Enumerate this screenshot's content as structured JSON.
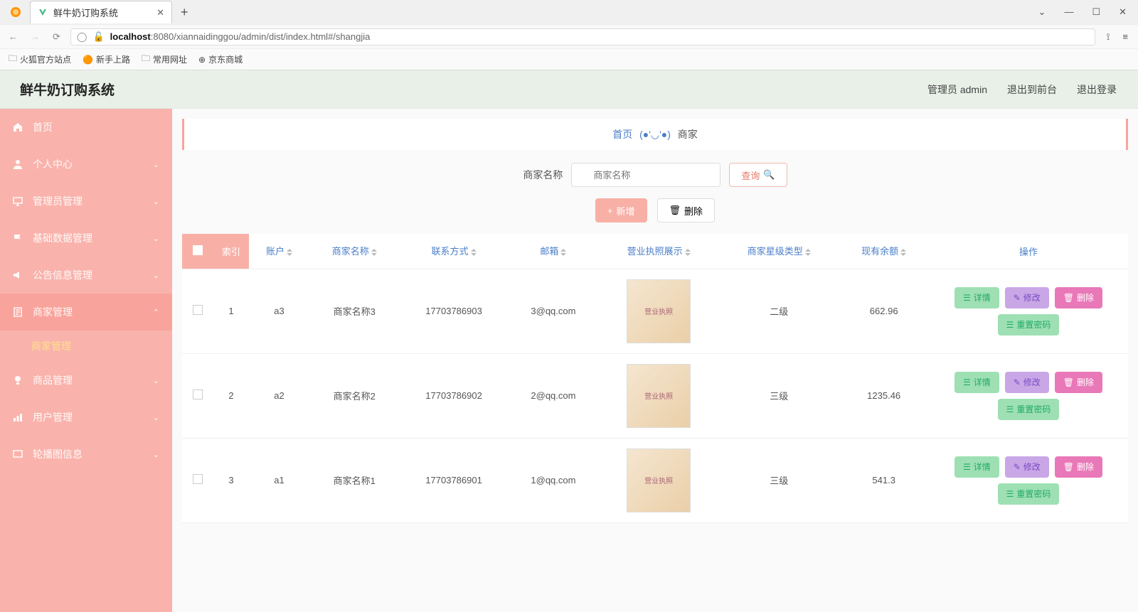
{
  "browser": {
    "tab_title": "鲜牛奶订购系统",
    "url_prefix": "localhost",
    "url_rest": ":8080/xiannaidinggou/admin/dist/index.html#/shangjia",
    "bookmarks": [
      "火狐官方站点",
      "新手上路",
      "常用网址",
      "京东商城"
    ]
  },
  "header": {
    "title": "鲜牛奶订购系统",
    "admin_label": "管理员 admin",
    "to_front": "退出到前台",
    "logout": "退出登录"
  },
  "sidebar": {
    "items": [
      {
        "label": "首页",
        "icon": "home"
      },
      {
        "label": "个人中心",
        "icon": "user",
        "expandable": true
      },
      {
        "label": "管理员管理",
        "icon": "monitor",
        "expandable": true
      },
      {
        "label": "基础数据管理",
        "icon": "flag",
        "expandable": true
      },
      {
        "label": "公告信息管理",
        "icon": "speaker",
        "expandable": true
      },
      {
        "label": "商家管理",
        "icon": "doc",
        "expandable": true,
        "open": true,
        "children": [
          {
            "label": "商家管理"
          }
        ]
      },
      {
        "label": "商品管理",
        "icon": "bulb",
        "expandable": true
      },
      {
        "label": "用户管理",
        "icon": "bars",
        "expandable": true
      },
      {
        "label": "轮播图信息",
        "icon": "screen",
        "expandable": true
      }
    ]
  },
  "breadcrumb": {
    "home": "首页",
    "face": "(●'◡'●)",
    "current": "商家"
  },
  "search": {
    "label": "商家名称",
    "placeholder": "商家名称",
    "query_btn": "查询"
  },
  "actions": {
    "add": "新增",
    "delete": "删除"
  },
  "table": {
    "headers": {
      "index": "索引",
      "account": "账户",
      "name": "商家名称",
      "contact": "联系方式",
      "email": "邮箱",
      "license": "营业执照展示",
      "level": "商家星级类型",
      "balance": "现有余额",
      "ops": "操作"
    },
    "rows": [
      {
        "idx": "1",
        "account": "a3",
        "name": "商家名称3",
        "contact": "17703786903",
        "email": "3@qq.com",
        "level": "二级",
        "balance": "662.96"
      },
      {
        "idx": "2",
        "account": "a2",
        "name": "商家名称2",
        "contact": "17703786902",
        "email": "2@qq.com",
        "level": "三级",
        "balance": "1235.46"
      },
      {
        "idx": "3",
        "account": "a1",
        "name": "商家名称1",
        "contact": "17703786901",
        "email": "1@qq.com",
        "level": "三级",
        "balance": "541.3"
      }
    ],
    "op_labels": {
      "detail": "详情",
      "edit": "修改",
      "del": "删除",
      "reset": "重置密码"
    }
  }
}
